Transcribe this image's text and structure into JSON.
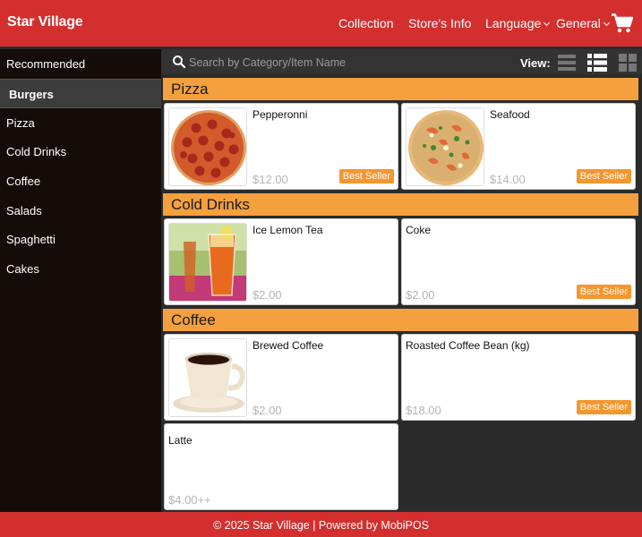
{
  "brand": {
    "name": "Star Village",
    "color": "#d32f2f"
  },
  "nav": {
    "collection": "Collection",
    "store_info": "Store's Info",
    "language": "Language",
    "general": "General"
  },
  "sidebar": {
    "items": [
      {
        "label": "Recommended"
      },
      {
        "label": "Burgers"
      },
      {
        "label": "Pizza"
      },
      {
        "label": "Cold Drinks"
      },
      {
        "label": "Coffee"
      },
      {
        "label": "Salads"
      },
      {
        "label": "Spaghetti"
      },
      {
        "label": "Cakes"
      }
    ],
    "active_label": "Burgers"
  },
  "search": {
    "placeholder": "Search by Category/Item Name",
    "value": ""
  },
  "view": {
    "label": "View:",
    "modes": [
      "list-view-icon",
      "detailed-list-view-icon",
      "grid-view-icon"
    ]
  },
  "categories": [
    {
      "name": "Pizza",
      "items": [
        {
          "name": "Pepperonni",
          "price": "$12.00",
          "badge": "Best Seller",
          "image": "pepperoni-pizza"
        },
        {
          "name": "Seafood",
          "price": "$14.00",
          "badge": "Best Seller",
          "image": "seafood-pizza"
        }
      ]
    },
    {
      "name": "Cold Drinks",
      "items": [
        {
          "name": "Ice Lemon Tea",
          "price": "$2.00",
          "image": "iced-tea-glass"
        },
        {
          "name": "Coke",
          "price": "$2.00",
          "badge": "Best Seller"
        }
      ]
    },
    {
      "name": "Coffee",
      "items": [
        {
          "name": "Brewed Coffee",
          "price": "$2.00",
          "image": "coffee-cup"
        },
        {
          "name": "Roasted Coffee Bean (kg)",
          "price": "$18.00",
          "badge": "Best Seller"
        },
        {
          "name": "Latte",
          "price": "$4.00++"
        }
      ]
    }
  ],
  "footer": {
    "text": "© 2025 Star Village | Powered by MobiPOS"
  },
  "colors": {
    "header": "#d32f2f",
    "category_bar": "#f4a03f",
    "badge": "#f5962f",
    "sidebar": "#140c08",
    "main_bg": "#2b2b2b"
  }
}
